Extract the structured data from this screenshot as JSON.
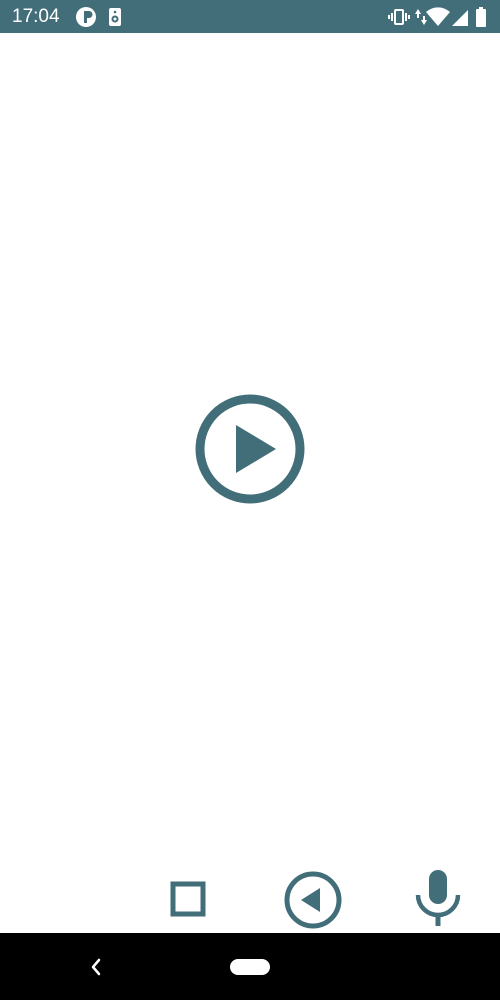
{
  "status_bar": {
    "time": "17:04",
    "icons": [
      "app-notification-icon",
      "speaker-icon",
      "vibrate-icon",
      "data-arrows-icon",
      "wifi-icon",
      "signal-icon",
      "battery-icon"
    ]
  },
  "main": {
    "play_button_icon": "play-circle-icon"
  },
  "toolbar": {
    "buttons": [
      "stop-icon",
      "back-circle-icon",
      "microphone-icon"
    ]
  },
  "nav_bar": {
    "buttons": [
      "nav-back-icon",
      "nav-home-pill"
    ]
  },
  "colors": {
    "accent": "#426e7a",
    "status_bar_bg": "#426e7a",
    "nav_bar_bg": "#000000",
    "background": "#ffffff"
  }
}
